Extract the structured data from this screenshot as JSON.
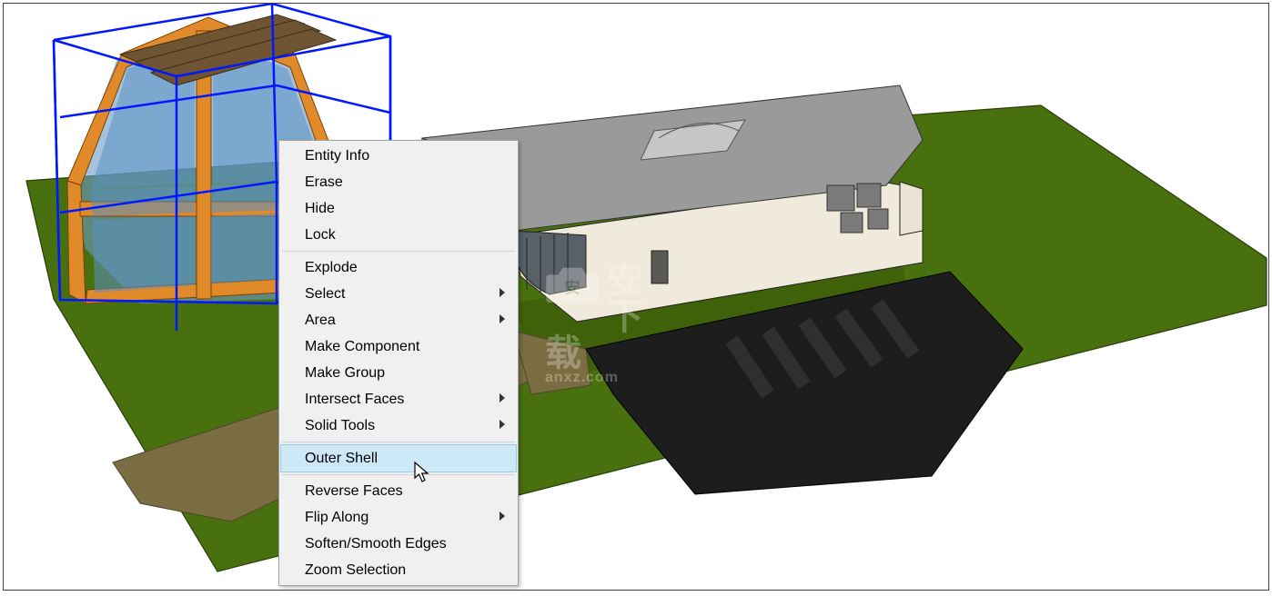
{
  "context_menu": {
    "group1": [
      {
        "label": "Entity Info",
        "submenu": false
      },
      {
        "label": "Erase",
        "submenu": false
      },
      {
        "label": "Hide",
        "submenu": false
      },
      {
        "label": "Lock",
        "submenu": false
      }
    ],
    "group2": [
      {
        "label": "Explode",
        "submenu": false
      },
      {
        "label": "Select",
        "submenu": true
      },
      {
        "label": "Area",
        "submenu": true
      },
      {
        "label": "Make Component",
        "submenu": false
      },
      {
        "label": "Make Group",
        "submenu": false
      },
      {
        "label": "Intersect Faces",
        "submenu": true
      },
      {
        "label": "Solid Tools",
        "submenu": true
      }
    ],
    "highlighted": {
      "label": "Outer Shell",
      "submenu": false
    },
    "group3": [
      {
        "label": "Reverse Faces",
        "submenu": false
      },
      {
        "label": "Flip Along",
        "submenu": true
      },
      {
        "label": "Soften/Smooth Edges",
        "submenu": false
      },
      {
        "label": "Zoom Selection",
        "submenu": false
      }
    ]
  },
  "watermark": {
    "title": "安下载",
    "url": "anxz.com"
  }
}
